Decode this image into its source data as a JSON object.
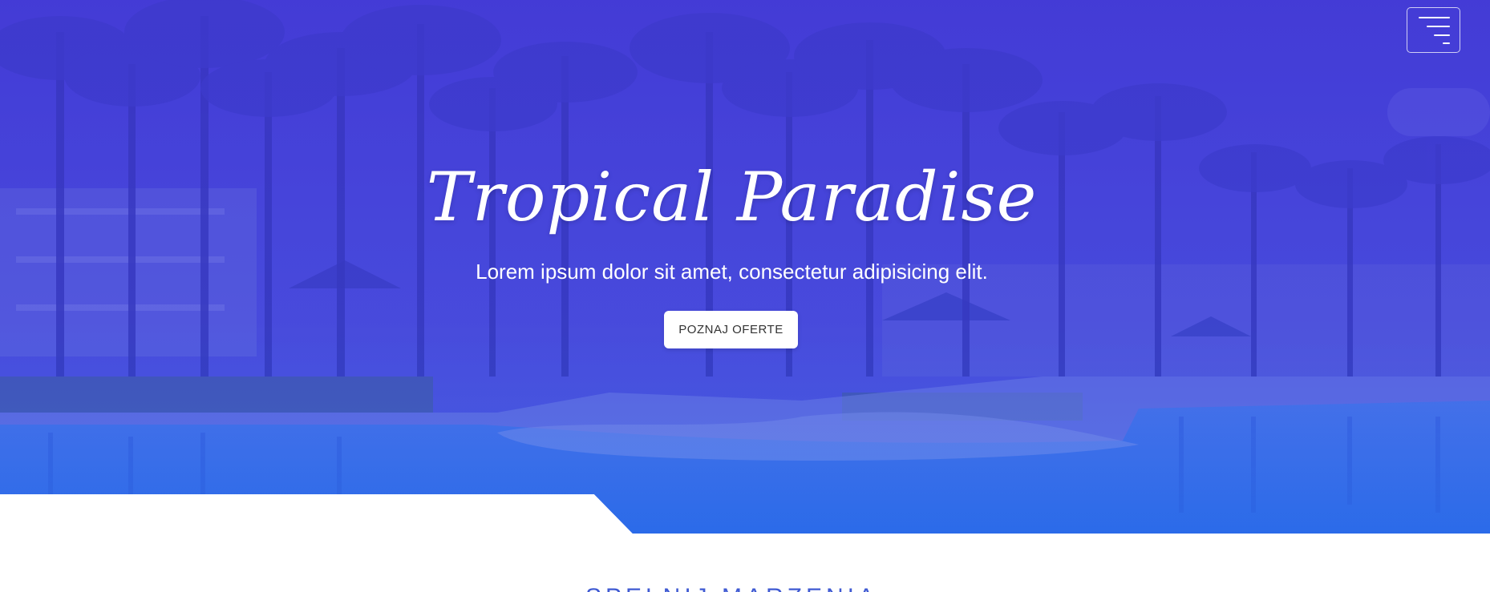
{
  "hero": {
    "title": "Tropical Paradise",
    "subtitle": "Lorem ipsum dolor sit amet, consectetur adipisicing elit.",
    "cta_label": "POZNAJ OFERTE",
    "background_scene": "tropical-resort-pool-palm-trees",
    "overlay_color": "#3c3fd0"
  },
  "navbar": {
    "menu_icon": "hamburger-menu-icon"
  },
  "section": {
    "heading": "SPEŁNIJ MARZENIA"
  },
  "colors": {
    "overlay_top": "#3c3fd0",
    "overlay_bottom": "#1f6fe8",
    "section_heading": "#3f5ad2",
    "button_bg": "#ffffff"
  }
}
